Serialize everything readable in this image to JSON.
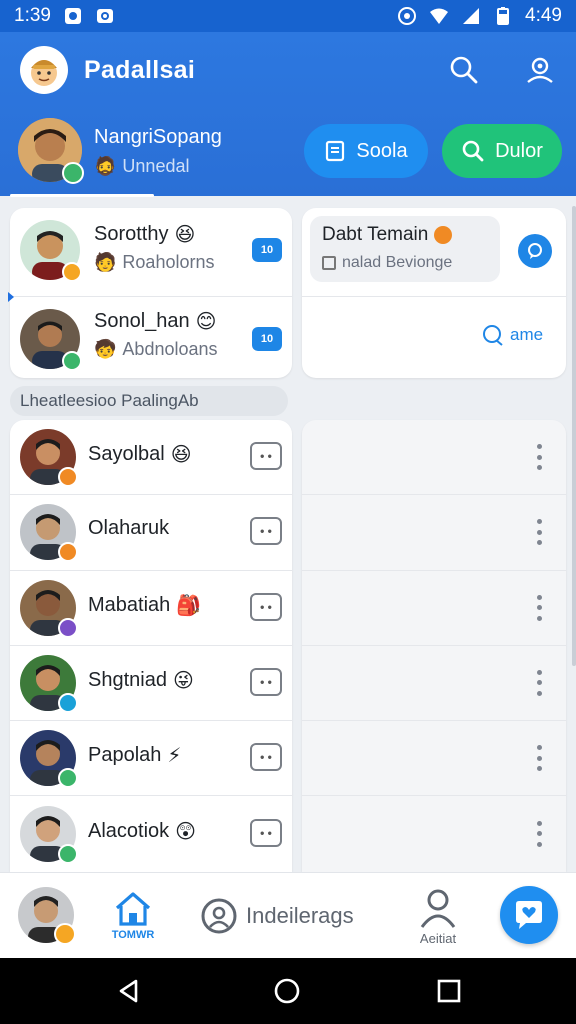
{
  "status_bar": {
    "time": "1:39",
    "clock_right": "4:49"
  },
  "header": {
    "app_title": "Padallsai",
    "profile_name": "NangriSopang",
    "profile_sub": "Unnedal",
    "actions": [
      "search-icon",
      "account-icon"
    ],
    "pill_primary": "Soola",
    "pill_secondary": "Dulor"
  },
  "colors": {
    "primary": "#2a6fd6",
    "accent_blue": "#1f8ef0",
    "accent_green": "#20c37a"
  },
  "top_cards": [
    {
      "name": "Sorotthy",
      "sub": "Roaholorns",
      "badge": "10"
    },
    {
      "name": "Sonol_han",
      "sub": "Abdnoloans",
      "badge": "10"
    }
  ],
  "right_card": {
    "title": "Dabt Temain",
    "sub": "nalad Bevionge",
    "link": "ame"
  },
  "section_title": "Lheatleesioo PaalingAb",
  "contacts": [
    {
      "name": "Sayolbal"
    },
    {
      "name": "Olaharuk"
    },
    {
      "name": "Mabatiah"
    },
    {
      "name": "Shgtniad"
    },
    {
      "name": "Papolah"
    },
    {
      "name": "Alacotiok"
    }
  ],
  "bottom_nav": {
    "home_label": "TOMWR",
    "middle_label": "Indeilerags",
    "profile_label": "Aeitiat"
  }
}
